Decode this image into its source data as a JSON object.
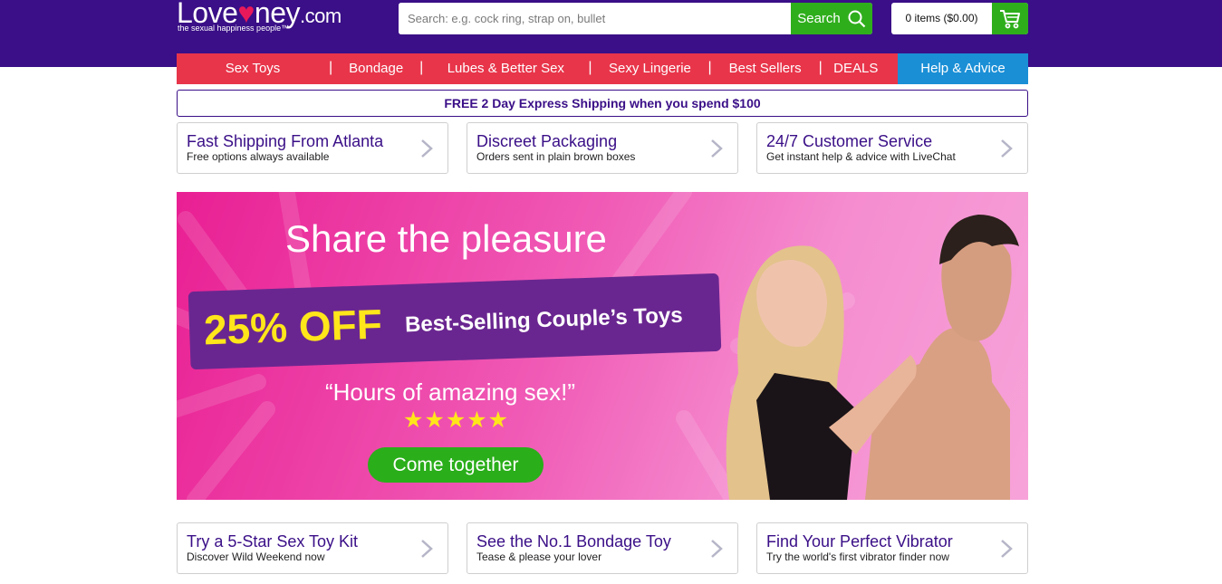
{
  "header": {
    "logo_main_1": "Love",
    "logo_heart": "♥",
    "logo_main_2": "ney",
    "logo_com": ".com",
    "logo_tagline": "the sexual happiness people™",
    "search_placeholder": "Search: e.g. cock ring, strap on, bullet",
    "search_button": "Search",
    "cart_text": "0 items ($0.00)"
  },
  "nav": {
    "items": [
      "Sex Toys",
      "Bondage",
      "Lubes & Better Sex",
      "Sexy Lingerie",
      "Best Sellers",
      "DEALS"
    ],
    "separator": "|",
    "help": "Help & Advice"
  },
  "shipping_bar": "FREE 2 Day Express Shipping when you spend $100",
  "features_top": [
    {
      "title": "Fast Shipping From Atlanta",
      "sub": "Free options always available"
    },
    {
      "title": "Discreet Packaging",
      "sub": "Orders sent in plain brown boxes"
    },
    {
      "title": "24/7 Customer Service",
      "sub": "Get instant help & advice with LiveChat"
    }
  ],
  "banner": {
    "title": "Share the pleasure",
    "off": "25% OFF",
    "promo": "Best-Selling Couple’s Toys",
    "quote": "“Hours of amazing sex!”",
    "stars": "★★★★★",
    "cta": "Come together"
  },
  "features_bottom": [
    {
      "title": "Try a 5-Star Sex Toy Kit",
      "sub": "Discover Wild Weekend now"
    },
    {
      "title": "See the No.1 Bondage Toy",
      "sub": "Tease & please your lover"
    },
    {
      "title": "Find Your Perfect Vibrator",
      "sub": "Try the world's first vibrator finder now"
    }
  ],
  "colors": {
    "header_purple": "#3a0f87",
    "nav_red": "#e8354a",
    "help_blue": "#1a8fd6",
    "action_green": "#2fae1c",
    "banner_pink": "#e91f93",
    "promo_yellow": "#ffe61a"
  }
}
